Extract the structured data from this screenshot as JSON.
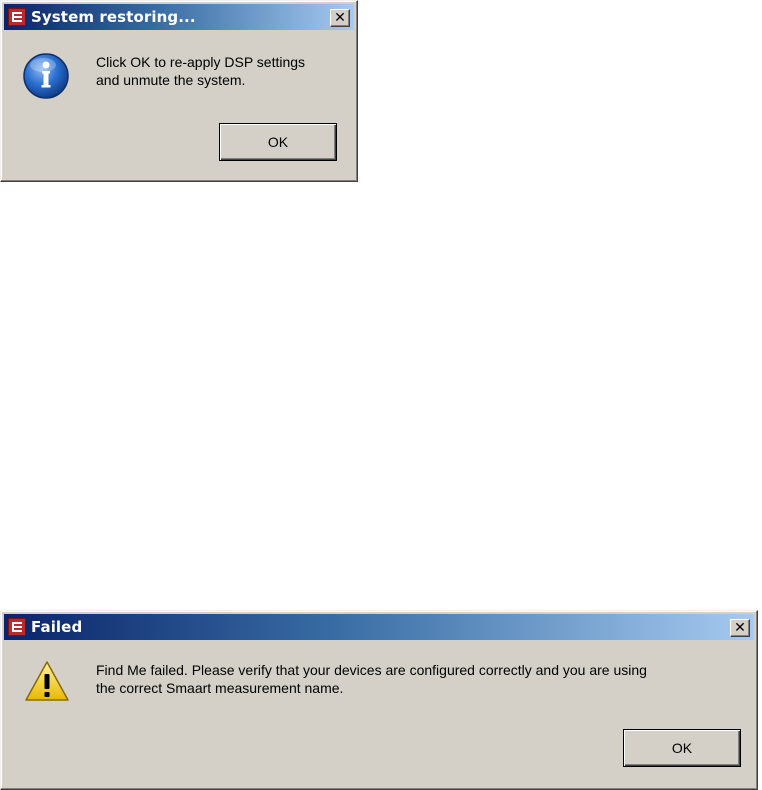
{
  "dialogs": [
    {
      "title": "System restoring...",
      "icon": "info-icon",
      "message": "Click OK to re-apply DSP settings\nand unmute the system.",
      "ok_label": "OK",
      "close_label": "✕"
    },
    {
      "title": "Failed",
      "icon": "warning-icon",
      "message": "Find Me failed. Please verify that your devices are configured correctly and you are using\nthe correct Smaart measurement name.",
      "ok_label": "OK",
      "close_label": "✕"
    }
  ],
  "colors": {
    "dialog_bg": "#d4d0c8",
    "titlebar_start": "#0a246a",
    "titlebar_end": "#a6caf0",
    "app_icon": "#b92b2b",
    "info_blue": "#1e5fc0",
    "warning_yellow": "#f5d328"
  }
}
